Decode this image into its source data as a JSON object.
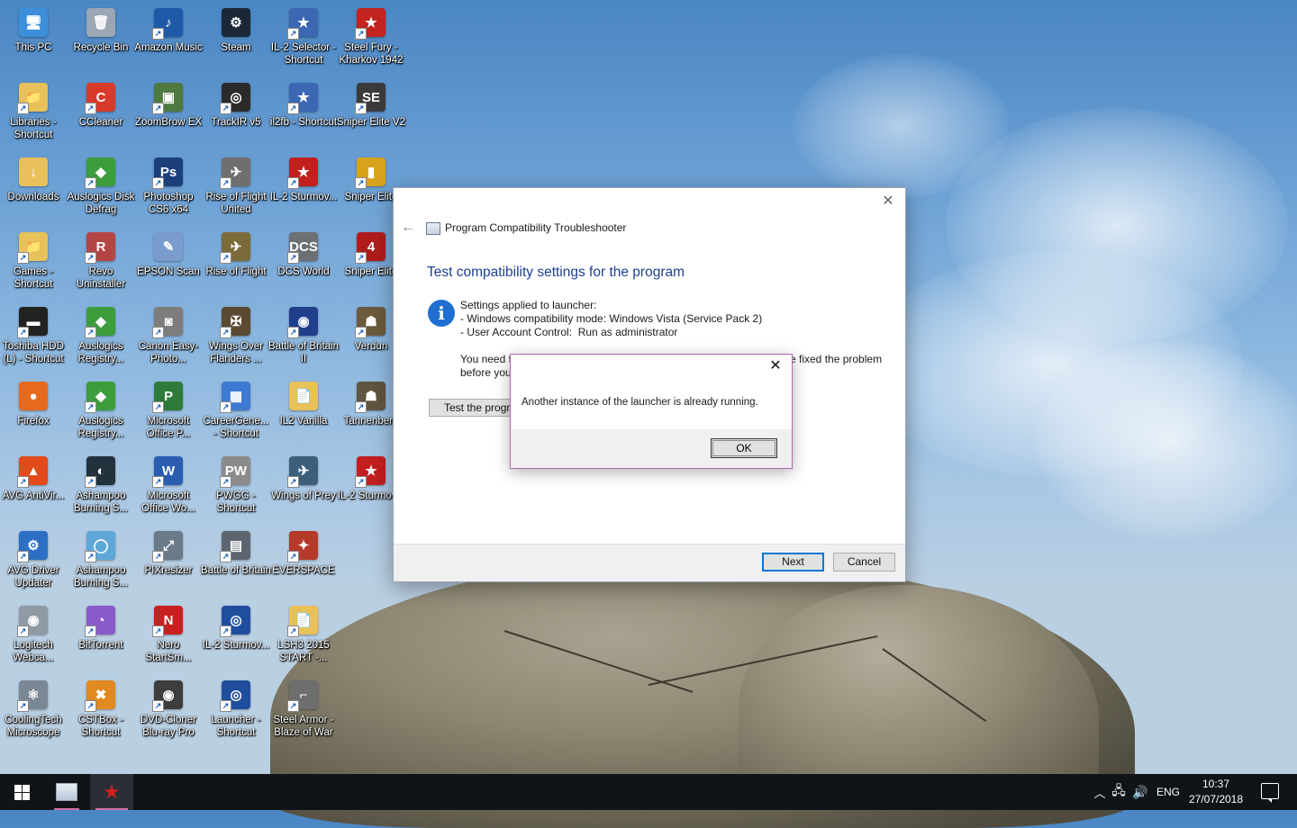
{
  "desktop": {
    "icons": [
      {
        "label": "This PC",
        "glyph": "🖥",
        "color": "#3c8fd8"
      },
      {
        "label": "Recycle Bin",
        "glyph": "🗑",
        "color": "#9aa7b4"
      },
      {
        "label": "Amazon Music",
        "glyph": "♪",
        "color": "#1e5aa8"
      },
      {
        "label": "Steam",
        "glyph": "⚙",
        "color": "#1b2838"
      },
      {
        "label": "IL-2 Selector - Shortcut",
        "glyph": "★",
        "color": "#3b67b3"
      },
      {
        "label": "Steel Fury - Kharkov 1942",
        "glyph": "★",
        "color": "#c2241f"
      },
      {
        "label": "Libraries - Shortcut",
        "glyph": "📁",
        "color": "#e8c15a"
      },
      {
        "label": "CCleaner",
        "glyph": "C",
        "color": "#d83a2a"
      },
      {
        "label": "ZoomBrow EX",
        "glyph": "▣",
        "color": "#4e7a3f"
      },
      {
        "label": "TrackIR v5",
        "glyph": "◎",
        "color": "#2b2b2b"
      },
      {
        "label": "il2fb - Shortcut",
        "glyph": "★",
        "color": "#3b67b3"
      },
      {
        "label": "Sniper Elite V2",
        "glyph": "SE",
        "color": "#3a3a3a"
      },
      {
        "label": "Downloads",
        "glyph": "↓",
        "color": "#e8c15a"
      },
      {
        "label": "Auslogics Disk Defrag",
        "glyph": "◆",
        "color": "#3c9d3c"
      },
      {
        "label": "Photoshop CS6 x64",
        "glyph": "Ps",
        "color": "#1c3f7a"
      },
      {
        "label": "Rise of Flight United",
        "glyph": "✈",
        "color": "#6f6f6f"
      },
      {
        "label": "IL-2 Sturmov...",
        "glyph": "★",
        "color": "#c21f1f"
      },
      {
        "label": "Sniper Elite",
        "glyph": "▮",
        "color": "#d9a21b"
      },
      {
        "label": "Games - Shortcut",
        "glyph": "📁",
        "color": "#e8c15a"
      },
      {
        "label": "Revo Uninstaller",
        "glyph": "R",
        "color": "#b34545"
      },
      {
        "label": "EPSON Scan",
        "glyph": "✎",
        "color": "#7a9ccc"
      },
      {
        "label": "Rise of Flight",
        "glyph": "✈",
        "color": "#7b6a3a"
      },
      {
        "label": "DCS World",
        "glyph": "DCS",
        "color": "#6c6f74"
      },
      {
        "label": "Sniper Elite",
        "glyph": "4",
        "color": "#b01c1c"
      },
      {
        "label": "Toshiba HDD (L) - Shortcut",
        "glyph": "▬",
        "color": "#222222"
      },
      {
        "label": "Auslogics Registry...",
        "glyph": "◆",
        "color": "#3c9d3c"
      },
      {
        "label": "Canon Easy-Photo...",
        "glyph": "◙",
        "color": "#7d7d7d"
      },
      {
        "label": "Wings Over Flanders ...",
        "glyph": "✠",
        "color": "#5a4a32"
      },
      {
        "label": "Battle of Britain II",
        "glyph": "◉",
        "color": "#1f3e8c"
      },
      {
        "label": "Verdun",
        "glyph": "☗",
        "color": "#6b5a3c"
      },
      {
        "label": "Firefox",
        "glyph": "●",
        "color": "#e66a1c"
      },
      {
        "label": "Auslogics Registry...",
        "glyph": "◆",
        "color": "#3c9d3c"
      },
      {
        "label": "Microsoft Office P...",
        "glyph": "P",
        "color": "#2e7a3a"
      },
      {
        "label": "CareerGene... - Shortcut",
        "glyph": "▦",
        "color": "#3d7ad1"
      },
      {
        "label": "IL2 Vanilla",
        "glyph": "📄",
        "color": "#e8c15a"
      },
      {
        "label": "Tannenberg",
        "glyph": "☗",
        "color": "#5f5540"
      },
      {
        "label": "AVG AntiVir...",
        "glyph": "▲",
        "color": "#e24a1a"
      },
      {
        "label": "Ashampoo Burning S...",
        "glyph": "◐",
        "color": "#22323d"
      },
      {
        "label": "Microsoft Office Wo...",
        "glyph": "W",
        "color": "#2a5db0"
      },
      {
        "label": "PWGG - Shortcut",
        "glyph": "PW",
        "color": "#8b8b8b"
      },
      {
        "label": "Wings of Prey",
        "glyph": "✈",
        "color": "#3e5f7a"
      },
      {
        "label": "IL-2 Sturmov...",
        "glyph": "★",
        "color": "#c21f1f"
      },
      {
        "label": "AVG Driver Updater",
        "glyph": "⚙",
        "color": "#2d6fc4"
      },
      {
        "label": "Ashampoo Burning S...",
        "glyph": "◯",
        "color": "#5fa7d8"
      },
      {
        "label": "PIXresizer",
        "glyph": "⤢",
        "color": "#6a7a88"
      },
      {
        "label": "Battle of Britain",
        "glyph": "▤",
        "color": "#5c6570"
      },
      {
        "label": "EVERSPACE",
        "glyph": "✦",
        "color": "#b53a2a"
      },
      {
        "label": "",
        "glyph": "",
        "color": ""
      },
      {
        "label": "Logitech Webca...",
        "glyph": "◉",
        "color": "#8f9aa3"
      },
      {
        "label": "BitTorrent",
        "glyph": "◔",
        "color": "#8a5ac9"
      },
      {
        "label": "Nero StartSm...",
        "glyph": "N",
        "color": "#c82020"
      },
      {
        "label": "IL-2 Sturmov...",
        "glyph": "◎",
        "color": "#1f4f9c"
      },
      {
        "label": "LSH3 2015 START -...",
        "glyph": "📄",
        "color": "#e8c15a"
      },
      {
        "label": "",
        "glyph": "",
        "color": ""
      },
      {
        "label": "CoolingTech Microscope",
        "glyph": "⚛",
        "color": "#7a8896"
      },
      {
        "label": "CSTBox - Shortcut",
        "glyph": "✖",
        "color": "#e08a1f"
      },
      {
        "label": "DVD-Cloner Blu-ray Pro",
        "glyph": "◉",
        "color": "#3d3d3d"
      },
      {
        "label": "Launcher - Shortcut",
        "glyph": "◎",
        "color": "#1f4f9c"
      },
      {
        "label": "Steel Armor - Blaze of War",
        "glyph": "⌐",
        "color": "#6e6e6e"
      }
    ]
  },
  "troubleshooter": {
    "title": "Program Compatibility Troubleshooter",
    "heading": "Test compatibility settings for the program",
    "settings_header": "Settings applied to launcher:",
    "settings_line1": "- Windows compatibility mode: Windows Vista (Service Pack 2)",
    "settings_line2": "- User Account Control:  Run as administrator",
    "note_left": "You need t",
    "note_right": "ve fixed the problem",
    "note_line2": "before you",
    "test_button": "Test the program...",
    "next_button": "Next",
    "cancel_button": "Cancel",
    "close_glyph": "✕",
    "back_glyph": "←"
  },
  "dialog": {
    "message": "Another instance of the launcher is already running.",
    "ok_button": "OK",
    "close_glyph": "✕"
  },
  "taskbar": {
    "start_glyph": "⊞",
    "language": "ENG",
    "time": "10:37",
    "date": "27/07/2018",
    "accent_color": "#d46fa4"
  }
}
